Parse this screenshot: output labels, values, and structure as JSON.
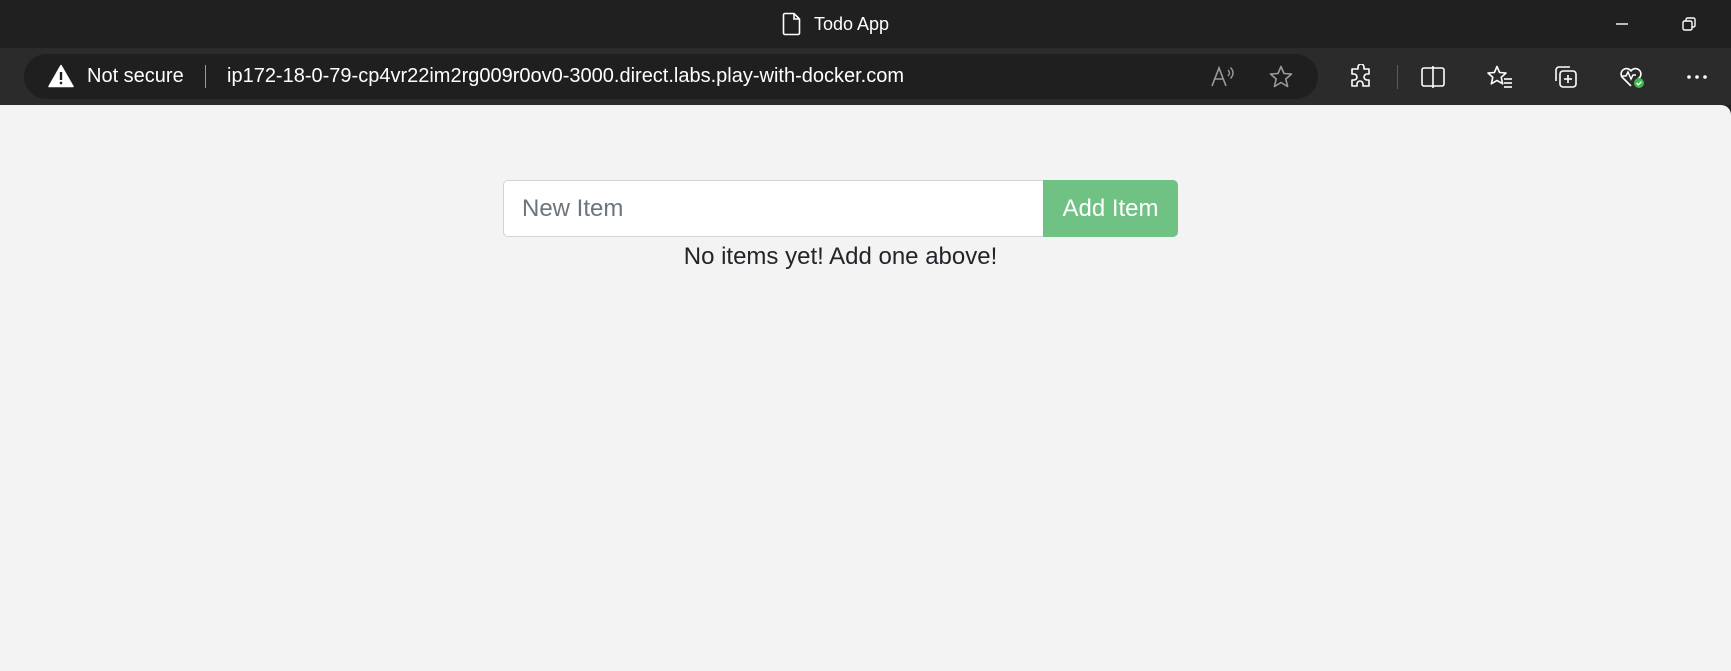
{
  "window": {
    "title": "Todo App",
    "icons": [
      "document-icon",
      "minimize-icon",
      "restore-icon"
    ]
  },
  "addressbar": {
    "security_label": "Not secure",
    "url": "ip172-18-0-79-cp4vr22im2rg009r0ov0-3000.direct.labs.play-with-docker.com"
  },
  "toolbar_icons": [
    "read-aloud-icon",
    "favorite-star-icon",
    "extensions-icon",
    "split-screen-icon",
    "favorites-icon",
    "collections-icon",
    "browser-essentials-icon",
    "more-icon"
  ],
  "colors": {
    "add_button": "#6fc284",
    "page_bg": "#f3f3f3",
    "chrome_bg": "#202020"
  },
  "todo": {
    "input_placeholder": "New Item",
    "input_value": "",
    "add_label": "Add Item",
    "empty_message": "No items yet! Add one above!"
  }
}
